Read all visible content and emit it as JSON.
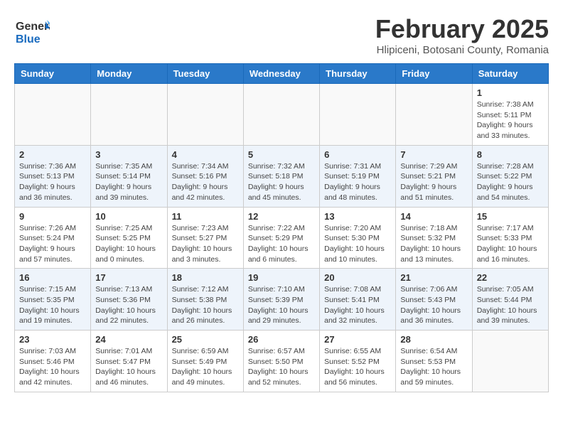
{
  "header": {
    "logo_line1": "General",
    "logo_line2": "Blue",
    "month_year": "February 2025",
    "location": "Hlipiceni, Botosani County, Romania"
  },
  "days_of_week": [
    "Sunday",
    "Monday",
    "Tuesday",
    "Wednesday",
    "Thursday",
    "Friday",
    "Saturday"
  ],
  "weeks": [
    [
      {
        "day": "",
        "info": ""
      },
      {
        "day": "",
        "info": ""
      },
      {
        "day": "",
        "info": ""
      },
      {
        "day": "",
        "info": ""
      },
      {
        "day": "",
        "info": ""
      },
      {
        "day": "",
        "info": ""
      },
      {
        "day": "1",
        "info": "Sunrise: 7:38 AM\nSunset: 5:11 PM\nDaylight: 9 hours and 33 minutes."
      }
    ],
    [
      {
        "day": "2",
        "info": "Sunrise: 7:36 AM\nSunset: 5:13 PM\nDaylight: 9 hours and 36 minutes."
      },
      {
        "day": "3",
        "info": "Sunrise: 7:35 AM\nSunset: 5:14 PM\nDaylight: 9 hours and 39 minutes."
      },
      {
        "day": "4",
        "info": "Sunrise: 7:34 AM\nSunset: 5:16 PM\nDaylight: 9 hours and 42 minutes."
      },
      {
        "day": "5",
        "info": "Sunrise: 7:32 AM\nSunset: 5:18 PM\nDaylight: 9 hours and 45 minutes."
      },
      {
        "day": "6",
        "info": "Sunrise: 7:31 AM\nSunset: 5:19 PM\nDaylight: 9 hours and 48 minutes."
      },
      {
        "day": "7",
        "info": "Sunrise: 7:29 AM\nSunset: 5:21 PM\nDaylight: 9 hours and 51 minutes."
      },
      {
        "day": "8",
        "info": "Sunrise: 7:28 AM\nSunset: 5:22 PM\nDaylight: 9 hours and 54 minutes."
      }
    ],
    [
      {
        "day": "9",
        "info": "Sunrise: 7:26 AM\nSunset: 5:24 PM\nDaylight: 9 hours and 57 minutes."
      },
      {
        "day": "10",
        "info": "Sunrise: 7:25 AM\nSunset: 5:25 PM\nDaylight: 10 hours and 0 minutes."
      },
      {
        "day": "11",
        "info": "Sunrise: 7:23 AM\nSunset: 5:27 PM\nDaylight: 10 hours and 3 minutes."
      },
      {
        "day": "12",
        "info": "Sunrise: 7:22 AM\nSunset: 5:29 PM\nDaylight: 10 hours and 6 minutes."
      },
      {
        "day": "13",
        "info": "Sunrise: 7:20 AM\nSunset: 5:30 PM\nDaylight: 10 hours and 10 minutes."
      },
      {
        "day": "14",
        "info": "Sunrise: 7:18 AM\nSunset: 5:32 PM\nDaylight: 10 hours and 13 minutes."
      },
      {
        "day": "15",
        "info": "Sunrise: 7:17 AM\nSunset: 5:33 PM\nDaylight: 10 hours and 16 minutes."
      }
    ],
    [
      {
        "day": "16",
        "info": "Sunrise: 7:15 AM\nSunset: 5:35 PM\nDaylight: 10 hours and 19 minutes."
      },
      {
        "day": "17",
        "info": "Sunrise: 7:13 AM\nSunset: 5:36 PM\nDaylight: 10 hours and 22 minutes."
      },
      {
        "day": "18",
        "info": "Sunrise: 7:12 AM\nSunset: 5:38 PM\nDaylight: 10 hours and 26 minutes."
      },
      {
        "day": "19",
        "info": "Sunrise: 7:10 AM\nSunset: 5:39 PM\nDaylight: 10 hours and 29 minutes."
      },
      {
        "day": "20",
        "info": "Sunrise: 7:08 AM\nSunset: 5:41 PM\nDaylight: 10 hours and 32 minutes."
      },
      {
        "day": "21",
        "info": "Sunrise: 7:06 AM\nSunset: 5:43 PM\nDaylight: 10 hours and 36 minutes."
      },
      {
        "day": "22",
        "info": "Sunrise: 7:05 AM\nSunset: 5:44 PM\nDaylight: 10 hours and 39 minutes."
      }
    ],
    [
      {
        "day": "23",
        "info": "Sunrise: 7:03 AM\nSunset: 5:46 PM\nDaylight: 10 hours and 42 minutes."
      },
      {
        "day": "24",
        "info": "Sunrise: 7:01 AM\nSunset: 5:47 PM\nDaylight: 10 hours and 46 minutes."
      },
      {
        "day": "25",
        "info": "Sunrise: 6:59 AM\nSunset: 5:49 PM\nDaylight: 10 hours and 49 minutes."
      },
      {
        "day": "26",
        "info": "Sunrise: 6:57 AM\nSunset: 5:50 PM\nDaylight: 10 hours and 52 minutes."
      },
      {
        "day": "27",
        "info": "Sunrise: 6:55 AM\nSunset: 5:52 PM\nDaylight: 10 hours and 56 minutes."
      },
      {
        "day": "28",
        "info": "Sunrise: 6:54 AM\nSunset: 5:53 PM\nDaylight: 10 hours and 59 minutes."
      },
      {
        "day": "",
        "info": ""
      }
    ]
  ]
}
